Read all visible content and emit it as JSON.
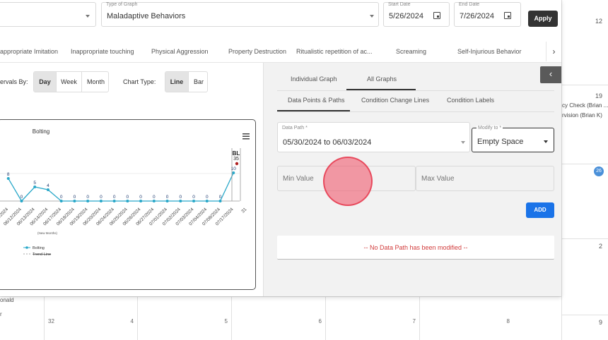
{
  "filters": {
    "graph_type_label": "Type of Graph",
    "graph_type_value": "Maladaptive Behaviors",
    "start_date_label": "Start Date",
    "start_date_value": "5/26/2024",
    "end_date_label": "End Date",
    "end_date_value": "7/26/2024",
    "apply_label": "Apply"
  },
  "behavior_tabs": [
    "appropriate Imitation",
    "Inappropriate touching",
    "Physical Aggression",
    "Property Destruction",
    "Ritualistic repetition of ac...",
    "Screaming",
    "Self-Injurious Behavior"
  ],
  "intervals": {
    "label": "ervals By:",
    "options": [
      "Day",
      "Week",
      "Month"
    ],
    "selected": "Day"
  },
  "chart_type": {
    "label": "Chart Type:",
    "options": [
      "Line",
      "Bar"
    ],
    "selected": "Line"
  },
  "chart_data": {
    "type": "line",
    "title": "Bolting",
    "x": [
      "2024",
      "06/11/2024",
      "06/12/2024",
      "06/13/2024",
      "06/14/2024",
      "06/17/2024",
      "06/18/2024",
      "06/19/2024",
      "06/20/2024",
      "06/24/2024",
      "06/25/2024",
      "06/26/2024",
      "06/27/2024",
      "07/01/2024",
      "07/02/2024",
      "07/03/2024",
      "07/04/2024",
      "07/08/2024",
      "07/17/2024",
      "31"
    ],
    "series": [
      {
        "name": "Bolting",
        "values": [
          null,
          8,
          0,
          5,
          4,
          0,
          0,
          0,
          0,
          0,
          0,
          0,
          0,
          0,
          0,
          0,
          0,
          0,
          10,
          null
        ]
      }
    ],
    "point_labels": [
      "",
      "8",
      "0",
      "5",
      "4",
      "0",
      "0",
      "0",
      "0",
      "0",
      "0",
      "0",
      "0",
      "0",
      "0",
      "0",
      "0",
      "0",
      "10",
      ""
    ],
    "baseline_label": "BL",
    "baseline_values": [
      "35"
    ],
    "x_note": "(New Months)",
    "legend": [
      "Bolting",
      "Trend Line"
    ],
    "colors": {
      "series": "#2aa8c9",
      "baseline": "#b02020"
    }
  },
  "right_panel": {
    "top_tabs": [
      "Individual Graph",
      "All Graphs"
    ],
    "top_selected": "All Graphs",
    "sub_tabs": [
      "Data Points & Paths",
      "Condition Change Lines",
      "Condition Labels"
    ],
    "sub_selected": "Data Points & Paths",
    "data_path_label": "Data Path *",
    "data_path_value": "05/30/2024 to 06/03/2024",
    "modify_to_label": "Modify to *",
    "modify_to_value": "Empty Space",
    "min_value_placeholder": "Min Value",
    "max_value_placeholder": "Max Value",
    "add_label": "ADD",
    "no_data_text": "-- No Data Path has been modified --"
  },
  "calendar": {
    "right_numbers": [
      "12",
      "19",
      "26",
      "2",
      "9"
    ],
    "right_events": [
      "cy Check (Brian ...",
      "rvision (Brian K)"
    ],
    "bottom_numbers": [
      "32",
      "4",
      "5",
      "6",
      "7",
      "8"
    ],
    "bottom_left_text": [
      "onald",
      "r"
    ]
  }
}
